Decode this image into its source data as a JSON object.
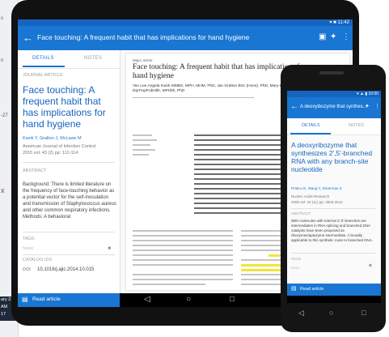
{
  "desktop": {
    "strip_labels": [
      "s",
      "n",
      "-27",
      "x"
    ],
    "clock_lines": [
      "ary 23",
      "AM",
      "17"
    ]
  },
  "tablet": {
    "status": "▾ ■ 11:42",
    "appbar": {
      "back_icon": "arrow-left-icon",
      "title": "Face touching: A frequent habit that has implications for hand hygiene",
      "icons": [
        "open-in-browser-icon",
        "share-icon",
        "more-vert-icon"
      ]
    },
    "tabs": [
      "DETAILS",
      "NOTES"
    ],
    "details": {
      "section_label": "JOURNAL ARTICLE",
      "title": "Face touching: A frequent habit that has implications for hand hygiene",
      "authors": "Kwok Y, Gralton J, McLaws M",
      "journal": "American Journal of Infection Control",
      "volume": "2015 vol: 43 (2) pp: 112-114",
      "abstract_label": "ABSTRACT",
      "abstract": "Background: There is limited literature on the frequency of face-touching behavior as a potential vector for the self-inoculation and transmission of Staphylococcus aureus and other common respiratory infections. Methods: A behavioral",
      "tags_label": "TAGS",
      "tags_value": "None",
      "catalog_label": "CATALOG IDS",
      "doi_label": "DOI",
      "doi": "10.1016/j.ajic.2014.10.015"
    },
    "bottom_action": "Read article",
    "pdf": {
      "tag": "Major article",
      "title": "Face touching: A frequent habit that has implications for hand hygiene",
      "authors": "Yen Lee Angela Kwok MMBS, MPH, MHM, PhD, Jan Gralton BSc (Hons), PhD, Mary-Louise McLaws DipTropPubHlth, MPHlth, PhD"
    },
    "nav_icons": [
      "◁",
      "○",
      "□"
    ]
  },
  "phone": {
    "status": "▾ ▲ ▮ 10:00",
    "appbar": {
      "back_icon": "arrow-left-icon",
      "title": "A deoxyibozyme that synthes...",
      "icons": [
        "share-icon",
        "more-vert-icon"
      ]
    },
    "tabs": [
      "DETAILS",
      "NOTES"
    ],
    "details": {
      "title": "A deoxyribozyme that synthesizes 2',5'-branched RNA with any branch-site nucleotide",
      "authors": "Pratico E, Wang Y, Silverman S",
      "journal": "Nucleic Acids Research",
      "volume": "2005 vol: 33 (11) pp: 3503-3512",
      "abstract_label": "ABSTRACT",
      "abstract": "With molecules with internal 2',5'-branches are intermediates in RNA splicing and branched DNA catalysts have been proposed as ribozymes/aptazyme intermediate. A broadly applicable to this synthetic route to branched DNA.",
      "tags_label": "TAGS",
      "tags_value": "None"
    },
    "bottom_action": "Read article",
    "nav_icons": [
      "◁",
      "○",
      "□"
    ]
  }
}
